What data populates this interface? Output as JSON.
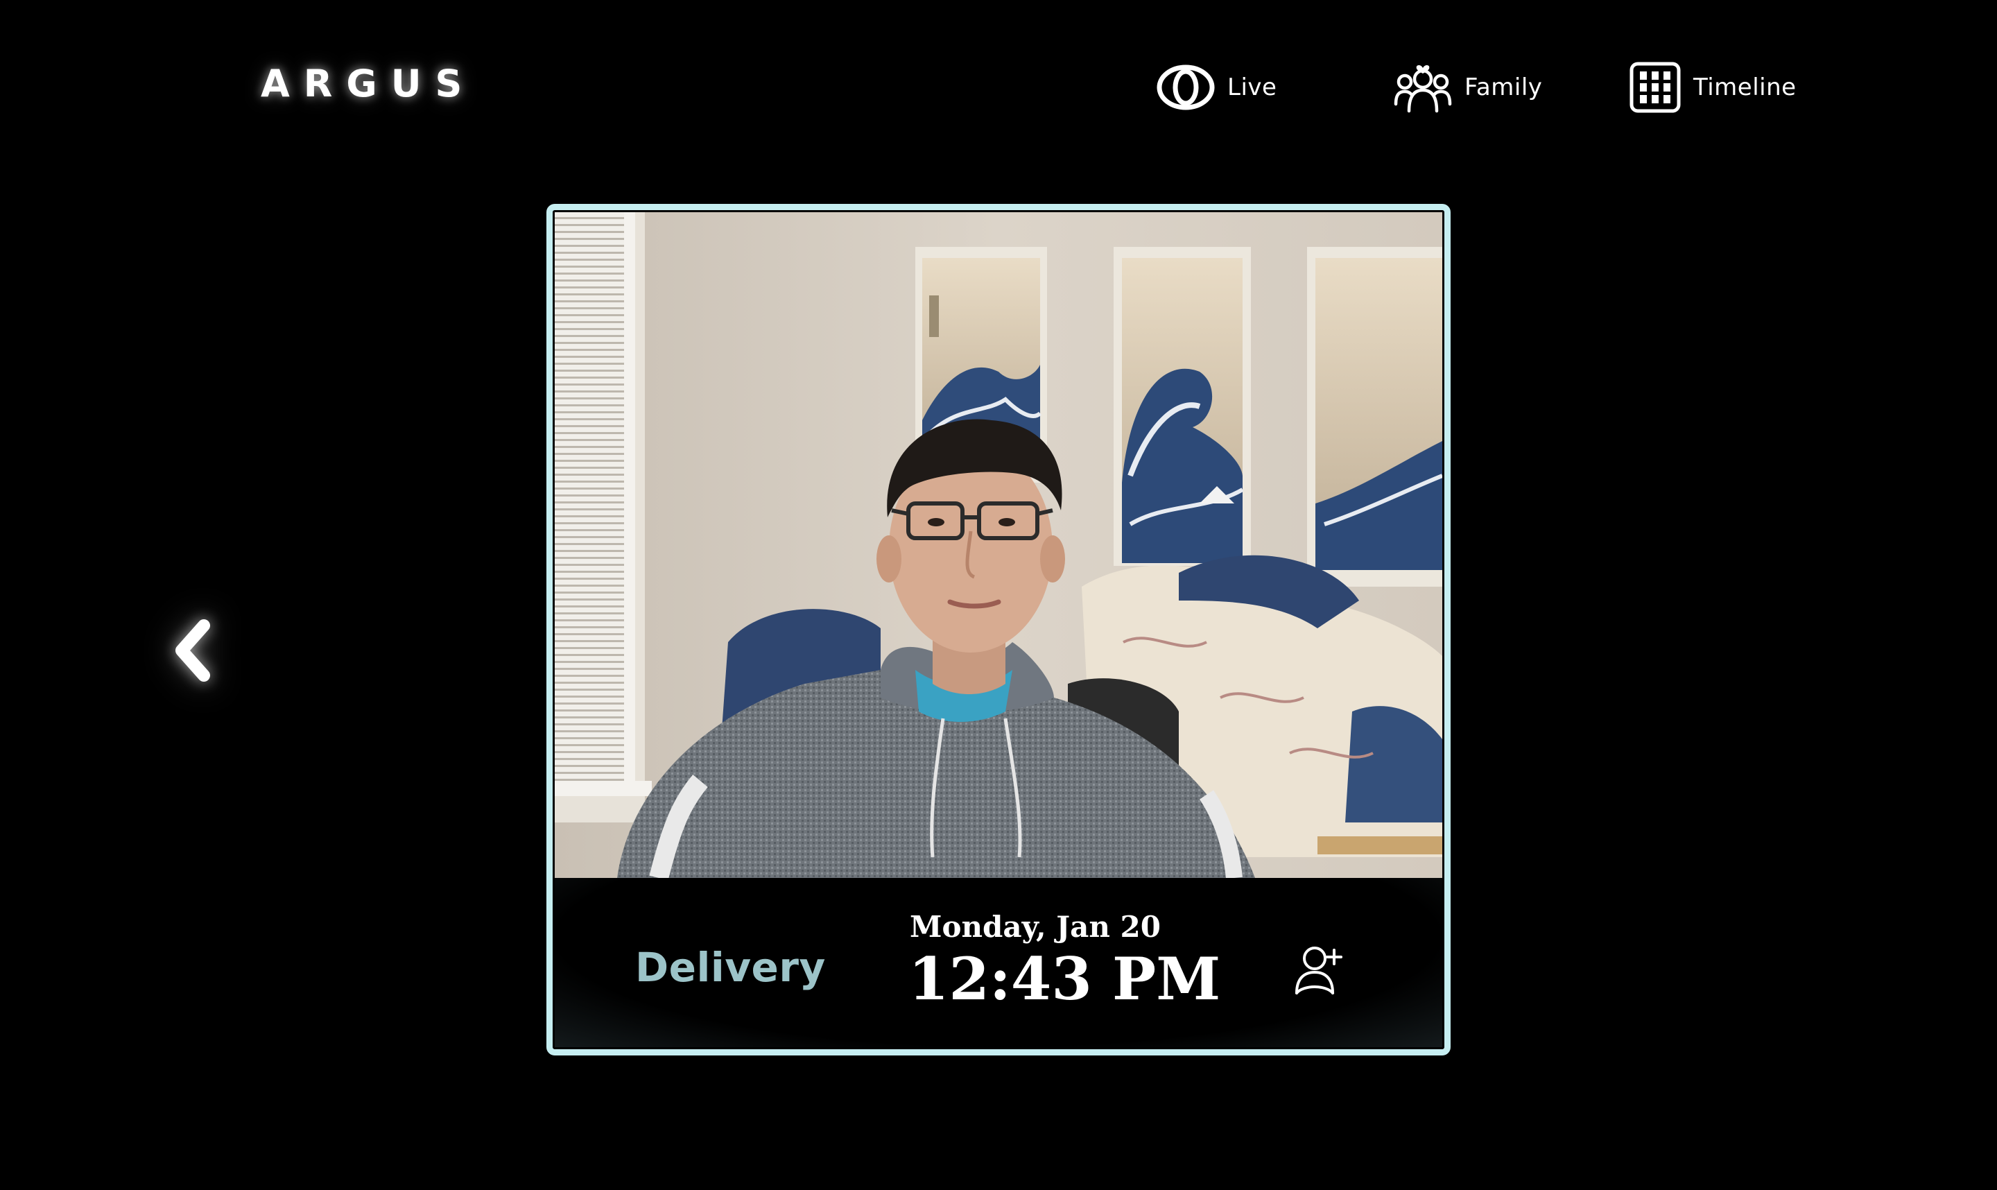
{
  "app": {
    "brand": "ARGUS"
  },
  "nav": {
    "items": [
      {
        "label": "Live",
        "icon": "eye-icon"
      },
      {
        "label": "Family",
        "icon": "family-icon"
      },
      {
        "label": "Timeline",
        "icon": "grid-icon"
      }
    ]
  },
  "back": {
    "icon": "chevron-left-icon"
  },
  "snapshot": {
    "image": "camera-snapshot",
    "tag": "Delivery",
    "date": "Monday, Jan 20",
    "time": "12:43 PM",
    "action_icon": "add-person-icon"
  },
  "colors": {
    "background": "#000000",
    "card_border": "#c6eef1",
    "tag_text": "#9cc3c8",
    "text": "#ffffff"
  }
}
